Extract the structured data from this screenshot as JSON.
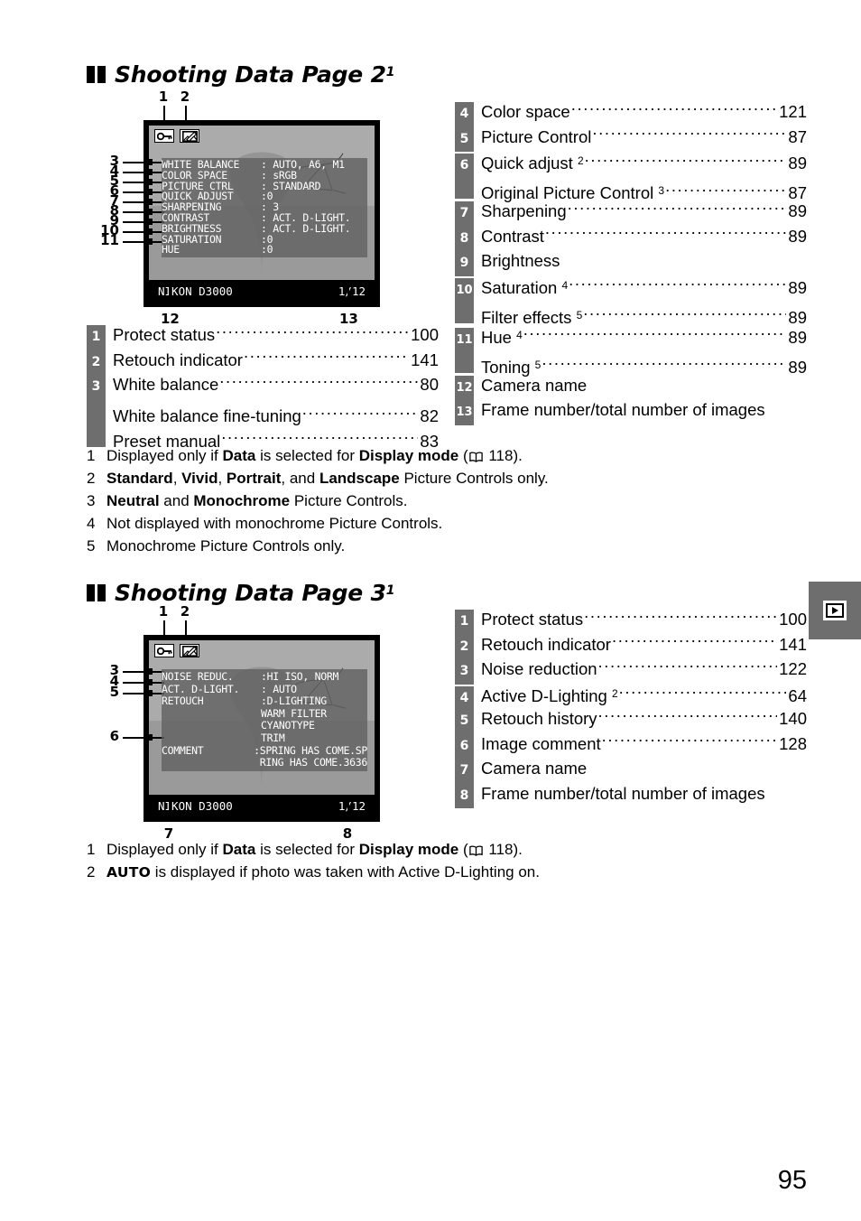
{
  "page": {
    "number": "95"
  },
  "side_tab": {
    "icon": "playback-icon"
  },
  "section1": {
    "heading": "Shooting Data Page 2",
    "heading_sup": "1",
    "figure": {
      "top_callouts": [
        "1",
        "2"
      ],
      "left_callouts": [
        "3",
        "4",
        "5",
        "6",
        "7",
        "8",
        "9",
        "10",
        "11"
      ],
      "bottom_callouts": [
        "12",
        "13"
      ],
      "icons": [
        "protect-key-icon",
        "retouch-icon"
      ],
      "rows": [
        {
          "label": "WHITE BALANCE",
          "value": ": AUTO, A6, M1"
        },
        {
          "label": "COLOR SPACE",
          "value": ": sRGB"
        },
        {
          "label": "PICTURE CTRL",
          "value": ": STANDARD"
        },
        {
          "label": "QUICK ADJUST",
          "value": ":0"
        },
        {
          "label": "SHARPENING",
          "value": ": 3"
        },
        {
          "label": "CONTRAST",
          "value": ": ACT. D-LIGHT."
        },
        {
          "label": "BRIGHTNESS",
          "value": ": ACT. D-LIGHT."
        },
        {
          "label": "SATURATION",
          "value": ":0"
        },
        {
          "label": "HUE",
          "value": ":0"
        }
      ],
      "camera_name": "NIKON D3000",
      "frame_number": "1/12"
    },
    "list_left": [
      {
        "num": "1",
        "label": "Protect status",
        "page": "100",
        "dots": true
      },
      {
        "num": "2",
        "label": "Retouch indicator ",
        "page": "141",
        "dots": true
      },
      {
        "num": "3",
        "label": "White balance ",
        "page": "80",
        "dots": true
      },
      {
        "num": "",
        "label": "White balance fine-tuning",
        "page": "82",
        "dots": true
      },
      {
        "num": "",
        "label": "Preset manual ",
        "page": "83",
        "dots": true
      }
    ],
    "list_right": [
      {
        "num": "4",
        "label": "Color space",
        "page": "121",
        "dots": true
      },
      {
        "num": "5",
        "label": "Picture Control ",
        "page": "87",
        "dots": true
      },
      {
        "num": "6",
        "label": "Quick adjust ",
        "sup": "2",
        "page": "89",
        "dots": true
      },
      {
        "num": "",
        "label": "Original Picture Control ",
        "sup": "3",
        "page": "87",
        "dots": true
      },
      {
        "num": "7",
        "label": "Sharpening",
        "page": "89",
        "dots": true
      },
      {
        "num": "8",
        "label": "Contrast ",
        "page": "89",
        "dots": true
      },
      {
        "num": "9",
        "label": "Brightness",
        "page": "",
        "dots": false
      },
      {
        "num": "10",
        "label": "Saturation ",
        "sup": "4",
        "page": "89",
        "dots": true
      },
      {
        "num": "",
        "label": "Filter effects ",
        "sup": "5",
        "page": "89",
        "dots": true
      },
      {
        "num": "11",
        "label": "Hue ",
        "sup": "4",
        "page": "89",
        "dots": true
      },
      {
        "num": "",
        "label": "Toning ",
        "sup": "5",
        "page": "89",
        "dots": true
      },
      {
        "num": "12",
        "label": "Camera name",
        "page": "",
        "dots": false
      },
      {
        "num": "13",
        "label": "Frame number/total number of images",
        "page": "",
        "dots": false
      }
    ],
    "footnotes": [
      {
        "num": "1",
        "parts": [
          {
            "t": "Displayed only if "
          },
          {
            "t": "Data",
            "b": true
          },
          {
            "t": " is selected for "
          },
          {
            "t": "Display mode",
            "b": true
          },
          {
            "t": " ("
          },
          {
            "t": "book-icon",
            "icon": true
          },
          {
            "t": " 118)."
          }
        ]
      },
      {
        "num": "2",
        "parts": [
          {
            "t": "Standard",
            "b": true
          },
          {
            "t": ", "
          },
          {
            "t": "Vivid",
            "b": true
          },
          {
            "t": ", "
          },
          {
            "t": "Portrait",
            "b": true
          },
          {
            "t": ", and "
          },
          {
            "t": "Landscape",
            "b": true
          },
          {
            "t": " Picture Controls only."
          }
        ]
      },
      {
        "num": "3",
        "parts": [
          {
            "t": "Neutral",
            "b": true
          },
          {
            "t": " and "
          },
          {
            "t": "Monochrome",
            "b": true
          },
          {
            "t": " Picture Controls."
          }
        ]
      },
      {
        "num": "4",
        "parts": [
          {
            "t": "Not displayed with monochrome Picture Controls."
          }
        ]
      },
      {
        "num": "5",
        "parts": [
          {
            "t": "Monochrome Picture Controls only."
          }
        ]
      }
    ]
  },
  "section2": {
    "heading": "Shooting Data Page 3",
    "heading_sup": "1",
    "figure": {
      "top_callouts": [
        "1",
        "2"
      ],
      "left_callouts": [
        "3",
        "4",
        "5",
        "6"
      ],
      "bottom_callouts": [
        "7",
        "8"
      ],
      "icons": [
        "protect-key-icon",
        "retouch-icon"
      ],
      "rows": [
        {
          "label": "NOISE REDUC.",
          "value": ":HI ISO, NORM"
        },
        {
          "label": "ACT. D-LIGHT.",
          "value": ": AUTO"
        },
        {
          "label": "RETOUCH",
          "value": ":D-LIGHTING"
        },
        {
          "label": "",
          "value": "WARM FILTER"
        },
        {
          "label": "",
          "value": "CYANOTYPE"
        },
        {
          "label": "",
          "value": "TRIM"
        },
        {
          "label": "COMMENT",
          "value": ":SPRING HAS COME.SP"
        },
        {
          "label": "",
          "value": "RING HAS COME.3636"
        }
      ],
      "camera_name": "NIKON D3000",
      "frame_number": "1/12"
    },
    "list_right": [
      {
        "num": "1",
        "label": "Protect status",
        "page": "100",
        "dots": true
      },
      {
        "num": "2",
        "label": "Retouch indicator",
        "page": "141",
        "dots": true
      },
      {
        "num": "3",
        "label": "Noise reduction ",
        "page": "122",
        "dots": true
      },
      {
        "num": "4",
        "label": "Active D-Lighting ",
        "sup": "2",
        "page": "64",
        "dots": true
      },
      {
        "num": "5",
        "label": "Retouch history",
        "page": "140",
        "dots": true
      },
      {
        "num": "6",
        "label": "Image comment ",
        "page": "128",
        "dots": true
      },
      {
        "num": "7",
        "label": "Camera name",
        "page": "",
        "dots": false
      },
      {
        "num": "8",
        "label": "Frame number/total number of images",
        "page": "",
        "dots": false
      }
    ],
    "footnotes": [
      {
        "num": "1",
        "parts": [
          {
            "t": "Displayed only if "
          },
          {
            "t": "Data",
            "b": true
          },
          {
            "t": " is selected for "
          },
          {
            "t": "Display mode",
            "b": true
          },
          {
            "t": " ("
          },
          {
            "t": "book-icon",
            "icon": true
          },
          {
            "t": " 118)."
          }
        ]
      },
      {
        "num": "2",
        "parts": [
          {
            "t": "AUTO",
            "mono": true
          },
          {
            "t": " is displayed if photo was taken with Active D-Lighting on."
          }
        ]
      }
    ]
  }
}
